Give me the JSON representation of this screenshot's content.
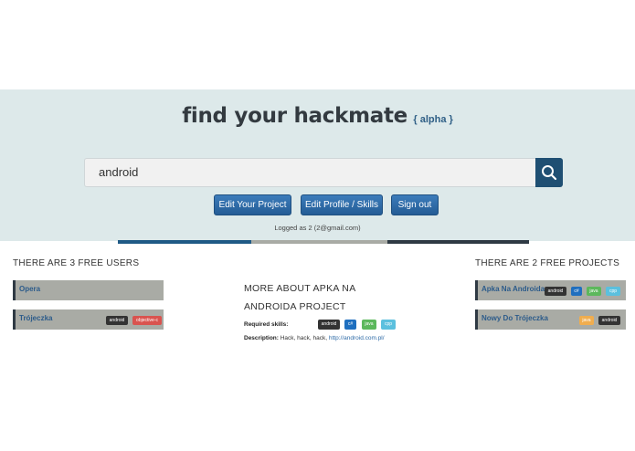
{
  "header": {
    "title": "find your hackmate",
    "alpha": "{ alpha }"
  },
  "search": {
    "value": "android",
    "icon": "search-icon"
  },
  "actions": {
    "edit_project": "Edit Your Project",
    "edit_profile": "Edit Profile / Skills",
    "sign_out": "Sign out"
  },
  "status": {
    "logged_as": "Logged as 2 (2@gmail.com)"
  },
  "users": {
    "title": "THERE ARE 3 FREE USERS",
    "items": [
      {
        "name": "Opera",
        "tags": []
      },
      {
        "name": "Trójeczka",
        "tags": [
          "android",
          "objective-c"
        ]
      }
    ]
  },
  "project": {
    "title_line1": "MORE ABOUT APKA NA",
    "title_line2": "ANDROIDA PROJECT",
    "skills_label": "Required skills:",
    "skills": [
      "android",
      "c#",
      "java",
      "cpp"
    ],
    "description_label": "Description:",
    "description_text": "Hack, hack, hack,",
    "description_link": "http://android.com.pl/"
  },
  "projects": {
    "title": "THERE ARE 2 FREE PROJECTS",
    "items": [
      {
        "name": "Apka Na Androida",
        "tags": [
          "android",
          "c#",
          "java",
          "cpp"
        ]
      },
      {
        "name": "Nowy Do Trójeczka",
        "tags": [
          "java",
          "android"
        ]
      }
    ]
  },
  "colors": {
    "hero_bg": "#dde9ea",
    "primary_button": "#2d6aa6",
    "search_button": "#1f4f73",
    "tag_android": "#333333",
    "tag_objc": "#d9534f",
    "tag_csharp": "#1f6fbf",
    "tag_java": "#5cb85c",
    "tag_cpp": "#5bc0de",
    "tag_java_orange": "#f0ad4e"
  }
}
